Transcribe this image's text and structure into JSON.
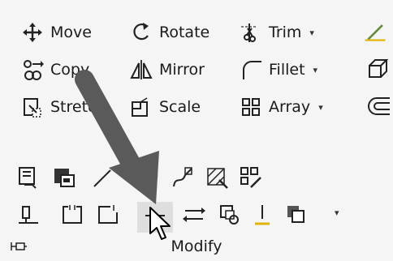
{
  "panel": {
    "title": "Modify",
    "commands": [
      {
        "label": "Move",
        "icon": "move-icon",
        "has_dropdown": false
      },
      {
        "label": "Rotate",
        "icon": "rotate-icon",
        "has_dropdown": false
      },
      {
        "label": "Trim",
        "icon": "trim-icon",
        "has_dropdown": true
      },
      {
        "label": "Copy",
        "icon": "copy-icon",
        "has_dropdown": false
      },
      {
        "label": "Mirror",
        "icon": "mirror-icon",
        "has_dropdown": false
      },
      {
        "label": "Fillet",
        "icon": "fillet-icon",
        "has_dropdown": true
      },
      {
        "label": "Stretch",
        "icon": "stretch-icon",
        "has_dropdown": false
      },
      {
        "label": "Scale",
        "icon": "scale-icon",
        "has_dropdown": false
      },
      {
        "label": "Array",
        "icon": "array-icon",
        "has_dropdown": true
      }
    ],
    "dropdown_glyph": "▾",
    "hovered_tool": "break-at-point-icon",
    "colors": {
      "background": "#f5f5f5",
      "arrow": "#5a5a5a",
      "hover": "#dedede",
      "accent_yellow": "#e0b300",
      "accent_red": "#d04030"
    }
  }
}
